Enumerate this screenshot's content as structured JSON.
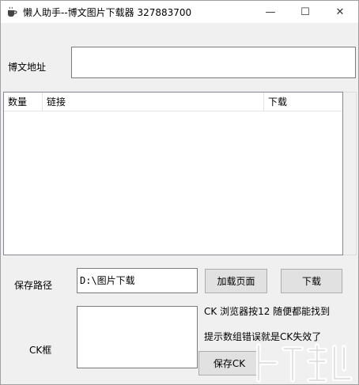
{
  "window": {
    "title": "懒人助手--博文图片下载器  327883700",
    "minimize_glyph": "—",
    "maximize_glyph": "☐",
    "close_glyph": "✕"
  },
  "form": {
    "blog_url_label": "博文地址",
    "blog_url_value": "",
    "save_path_label": "保存路径",
    "save_path_value": "D:\\图片下载",
    "ck_label": "CK框",
    "ck_value": ""
  },
  "list": {
    "columns": [
      "数量",
      "链接",
      "下载"
    ],
    "rows": []
  },
  "buttons": {
    "load_page": "加载页面",
    "download": "下载",
    "save_ck": "保存CK"
  },
  "hints": {
    "ck_hint": "CK 浏览器按12 随便都能找到",
    "error_hint": "提示数组错误就是CK失效了"
  },
  "icons": {
    "app": "coffee-cup-icon",
    "watermark": "site-logo-icon"
  }
}
